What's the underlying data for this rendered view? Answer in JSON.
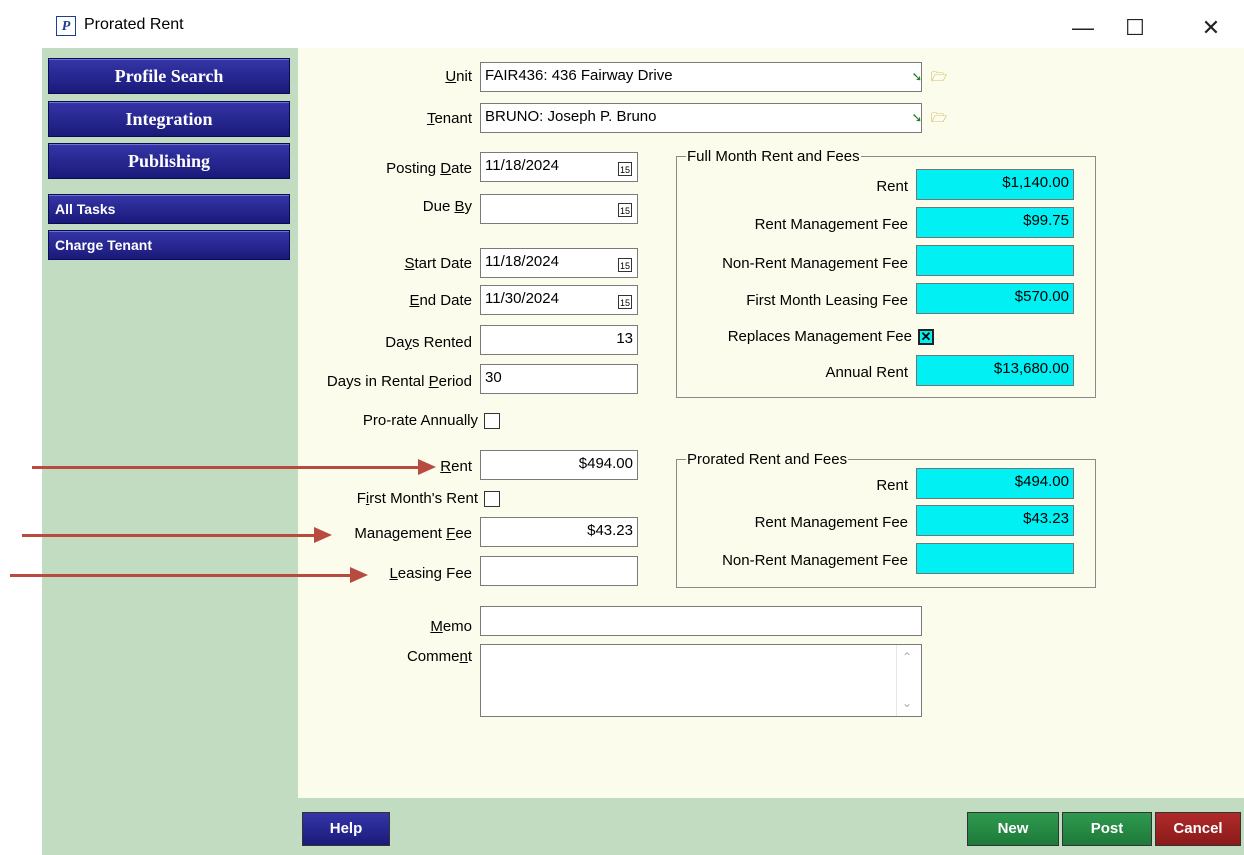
{
  "window": {
    "title": "Prorated Rent",
    "app_icon_letter": "P",
    "minimize_glyph": "—",
    "maximize_glyph": "☐",
    "close_glyph": "✕"
  },
  "sidebar": {
    "big_buttons": [
      "Profile Search",
      "Integration",
      "Publishing"
    ],
    "small_buttons": [
      "All Tasks",
      "Charge Tenant"
    ]
  },
  "form": {
    "unit": {
      "label_u": "U",
      "label_rest": "nit",
      "value": "FAIR436: 436 Fairway Drive"
    },
    "tenant": {
      "label_u": "T",
      "label_rest": "enant",
      "value": "BRUNO: Joseph P. Bruno"
    },
    "posting_date": {
      "label_pre": "Posting ",
      "label_u": "D",
      "label_rest": "ate",
      "value": "11/18/2024"
    },
    "due_by": {
      "label_pre": "Due ",
      "label_u": "B",
      "label_rest": "y",
      "value": ""
    },
    "start_date": {
      "label_u": "S",
      "label_rest": "tart Date",
      "value": "11/18/2024"
    },
    "end_date": {
      "label_u": "E",
      "label_rest": "nd Date",
      "value": "11/30/2024"
    },
    "days_rented": {
      "label_pre": "Da",
      "label_u": "y",
      "label_rest": "s Rented",
      "value": "13"
    },
    "days_in_period": {
      "label_pre": "Days in Rental ",
      "label_u": "P",
      "label_rest": "eriod",
      "value": "30"
    },
    "prorate_annually": {
      "label": "Pro-rate Annually",
      "checked": false
    },
    "rent": {
      "label_u": "R",
      "label_rest": "ent",
      "value": "$494.00"
    },
    "first_months_rent": {
      "label_pre": "F",
      "label_u": "i",
      "label_rest": "rst Month's Rent",
      "checked": false
    },
    "management_fee": {
      "label_pre": "Management ",
      "label_u": "F",
      "label_rest": "ee",
      "value": "$43.23"
    },
    "leasing_fee": {
      "label_u": "L",
      "label_rest": "easing Fee",
      "value": ""
    },
    "memo": {
      "label_u": "M",
      "label_rest": "emo",
      "value": ""
    },
    "comment": {
      "label_pre": "Comme",
      "label_u": "n",
      "label_rest": "t",
      "value": ""
    }
  },
  "full_month": {
    "title": "Full Month Rent and Fees",
    "rent_label": "Rent",
    "rent_value": "$1,140.00",
    "rmf_label": "Rent Management Fee",
    "rmf_value": "$99.75",
    "nrmf_label": "Non-Rent Management Fee",
    "nrmf_value": "",
    "fmlf_label": "First Month Leasing Fee",
    "fmlf_value": "$570.00",
    "replaces_label": "Replaces Management Fee",
    "replaces_checked": true,
    "annual_label": "Annual Rent",
    "annual_value": "$13,680.00"
  },
  "prorated": {
    "title": "Prorated Rent and Fees",
    "rent_label": "Rent",
    "rent_value": "$494.00",
    "rmf_label": "Rent Management Fee",
    "rmf_value": "$43.23",
    "nrmf_label": "Non-Rent Management Fee",
    "nrmf_value": ""
  },
  "footer": {
    "help": "Help",
    "new": "New",
    "post": "Post",
    "cancel": "Cancel"
  },
  "colors": {
    "nav_blue": "#1a1a7a",
    "cyan_field": "#00f0f4",
    "green_btn": "#1e7a3a",
    "red_btn": "#8a1a1a",
    "arrow": "#b84a40"
  }
}
